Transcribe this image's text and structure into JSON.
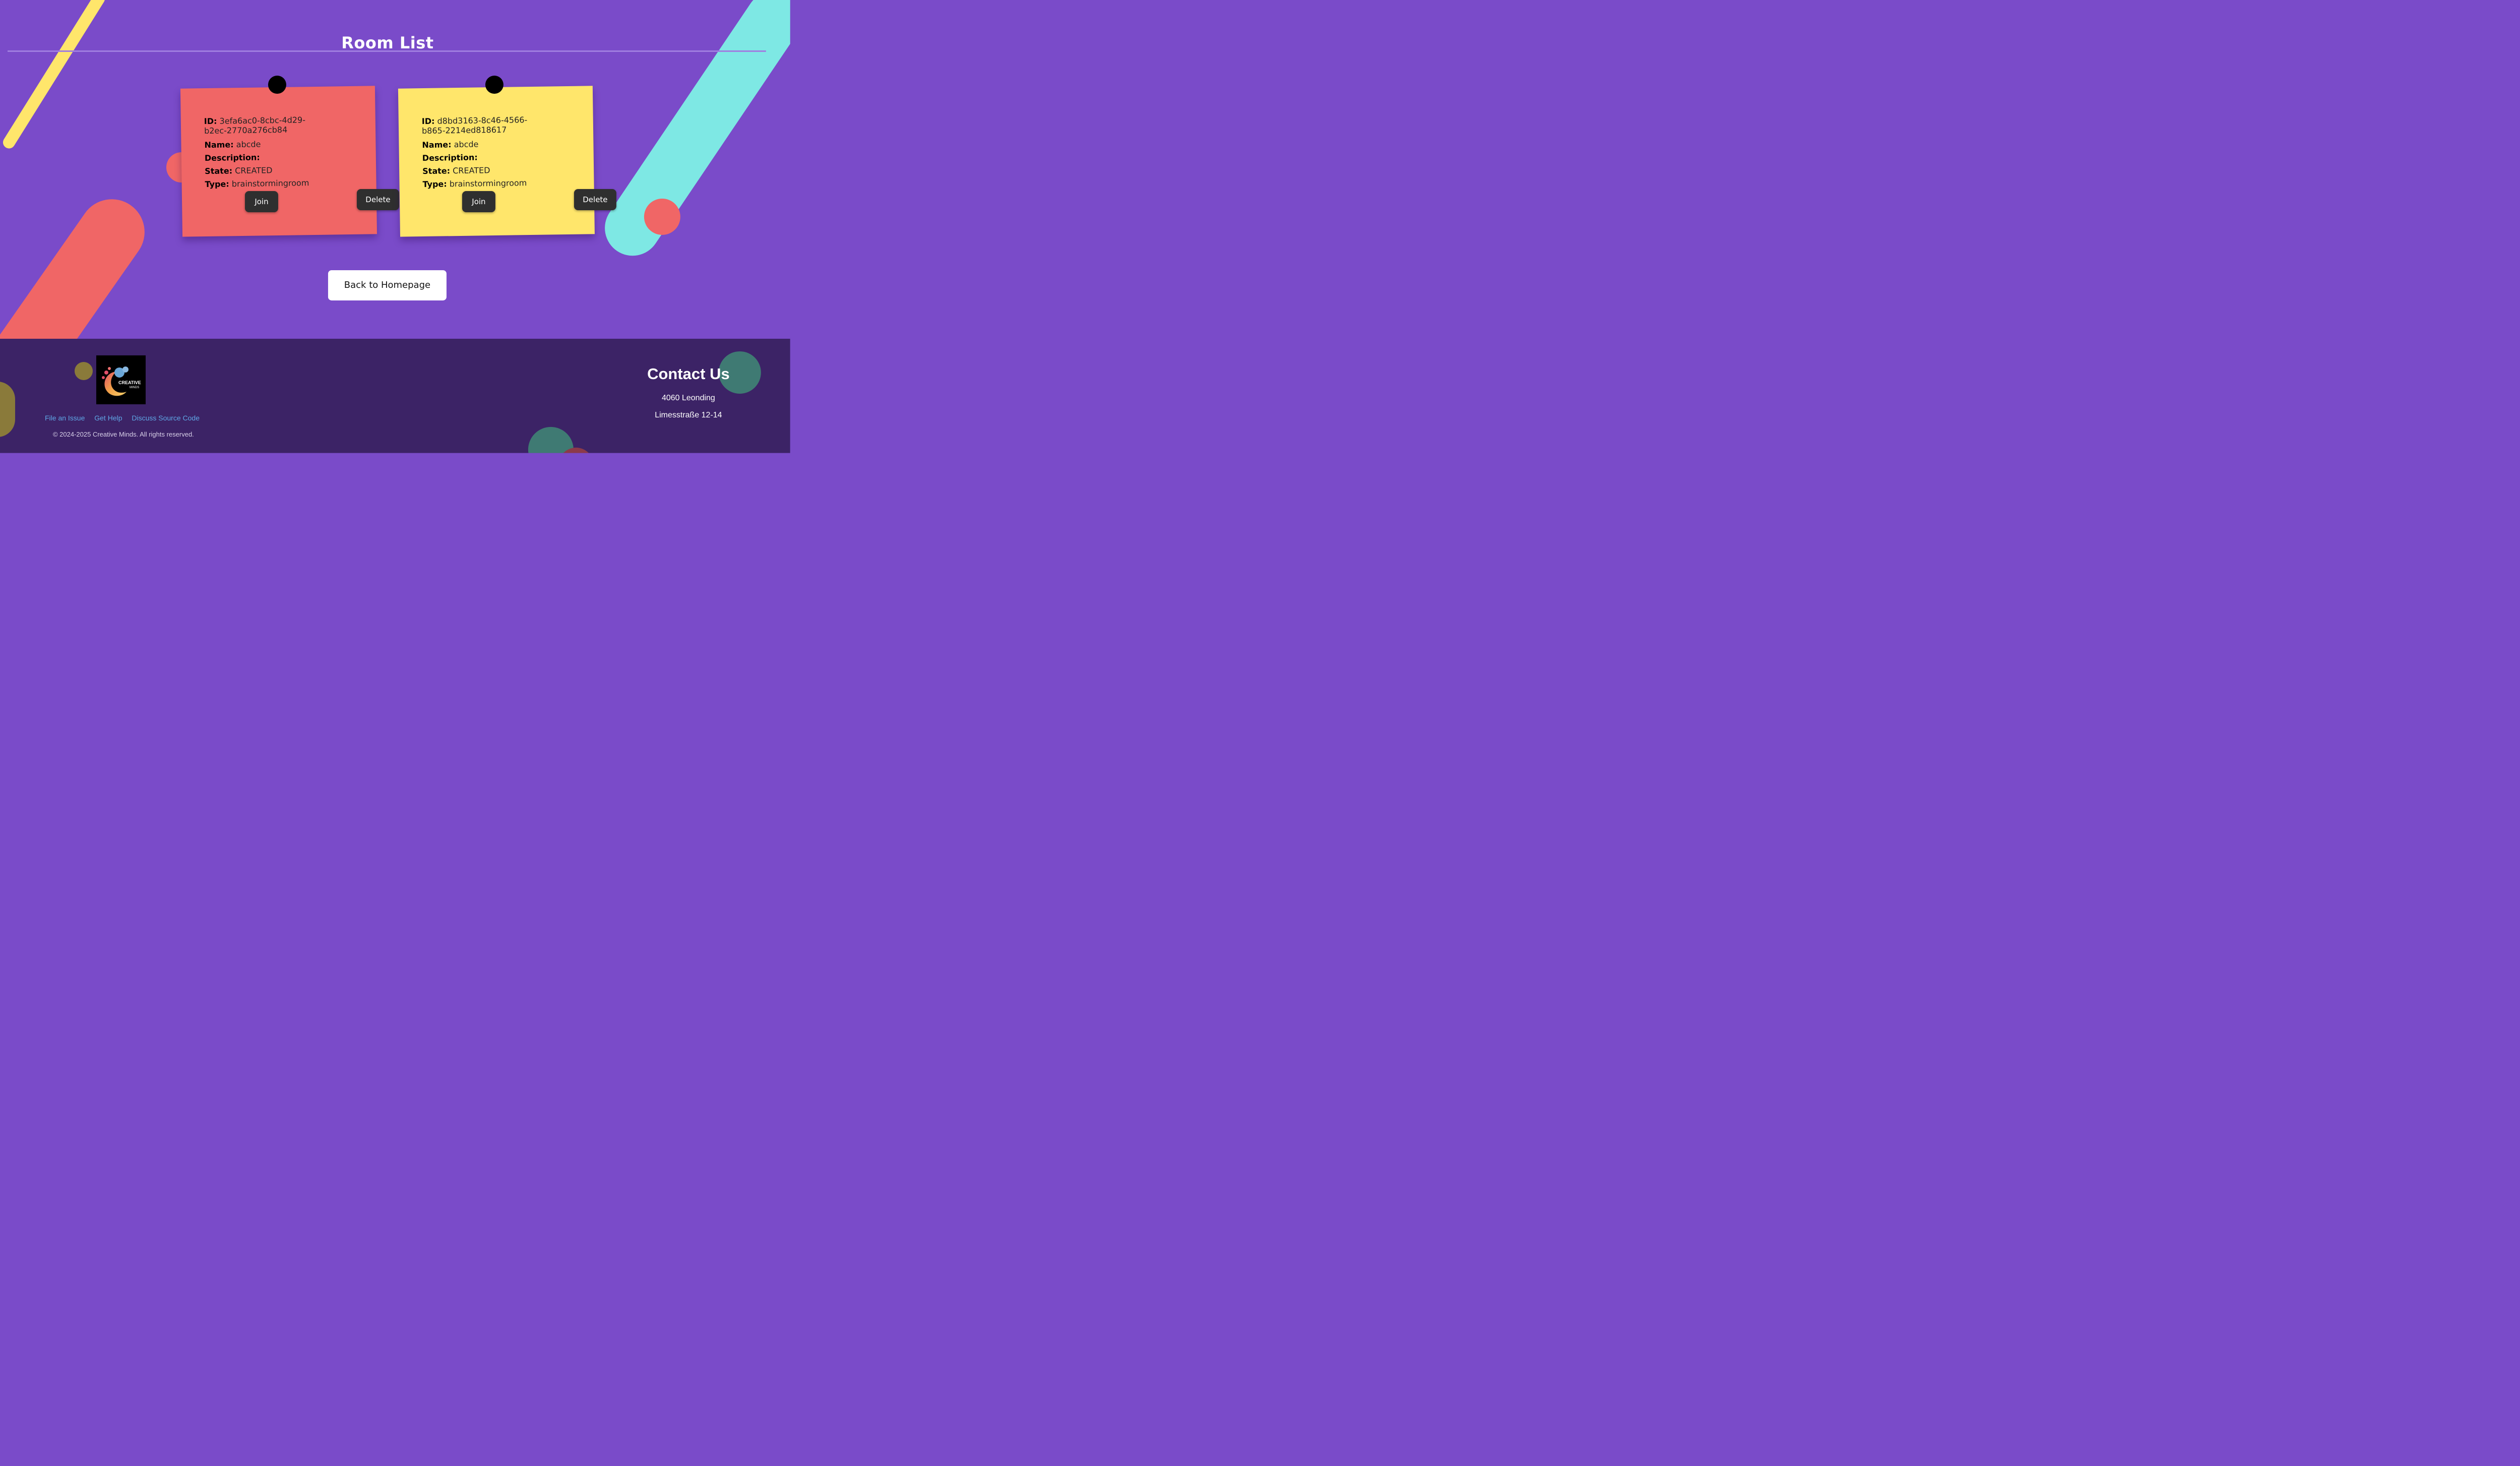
{
  "page": {
    "title": "Room List"
  },
  "rooms": [
    {
      "id_label": "ID:",
      "id_value": "3efa6ac0-8cbc-4d29-b2ec-2770a276cb84",
      "id_line1": "3efa6ac0-8cbc-4d29-",
      "id_line2": "b2ec-2770a276cb84",
      "name_label": "Name:",
      "name": "abcde",
      "description_label": "Description:",
      "description": "",
      "state_label": "State:",
      "state": "CREATED",
      "type_label": "Type:",
      "type": "brainstormingroom",
      "join_label": "Join",
      "delete_label": "Delete",
      "color": "#f06666"
    },
    {
      "id_label": "ID:",
      "id_value": "d8bd3163-8c46-4566-b865-2214ed818617",
      "id_line1": "d8bd3163-8c46-4566-",
      "id_line2": "b865-2214ed818617",
      "name_label": "Name:",
      "name": "abcde",
      "description_label": "Description:",
      "description": "",
      "state_label": "State:",
      "state": "CREATED",
      "type_label": "Type:",
      "type": "brainstormingroom",
      "join_label": "Join",
      "delete_label": "Delete",
      "color": "#ffe66b"
    }
  ],
  "back_button": {
    "label": "Back to Homepage"
  },
  "footer": {
    "logo_text": "CREATIVE",
    "logo_subtext": "MINDS",
    "links": [
      "File an Issue",
      "Get Help",
      "Discuss Source Code"
    ],
    "copyright": "© 2024-2025 Creative Minds. All rights reserved.",
    "contact_title": "Contact Us",
    "address_line1": "4060 Leonding",
    "address_line2": "Limesstraße 12-14"
  },
  "colors": {
    "background": "#7a4bc9",
    "footer": "#3c2366",
    "note_red": "#f06666",
    "note_yellow": "#ffe66b",
    "button_dark": "#2f2f2f",
    "link": "#5fa7e6"
  }
}
